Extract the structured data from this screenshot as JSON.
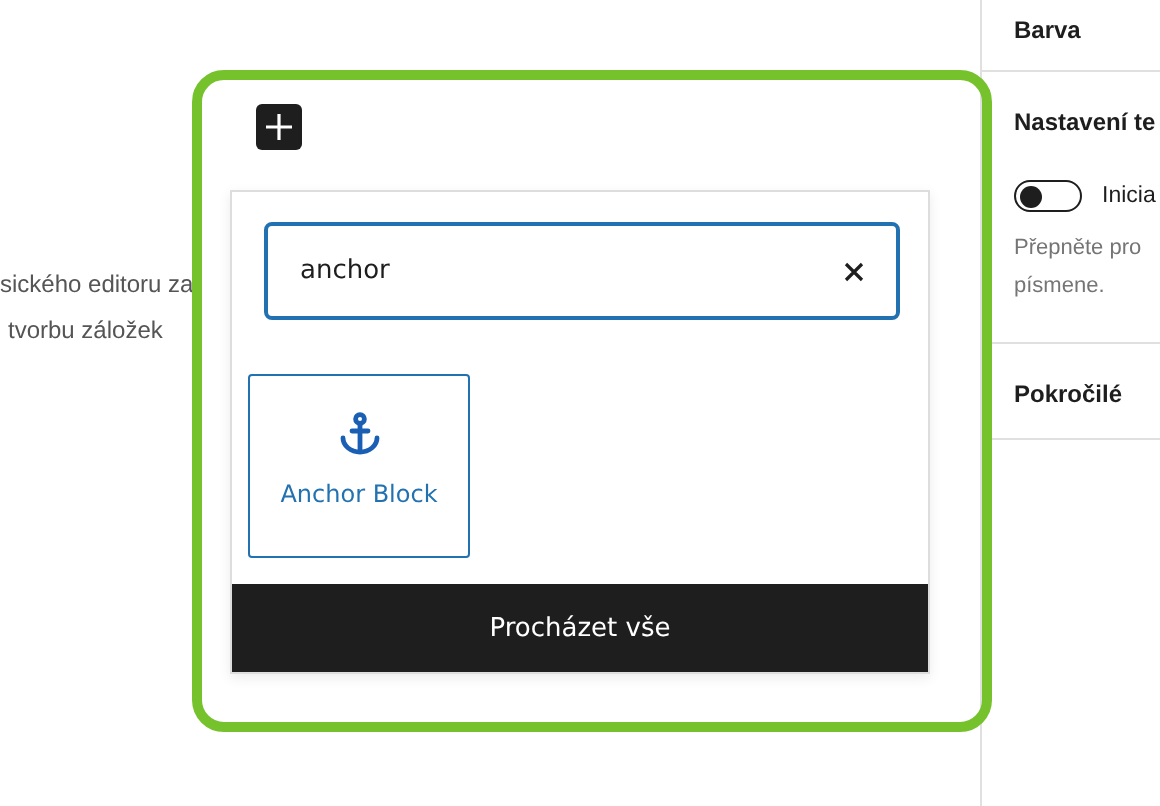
{
  "editor": {
    "lines": [
      "sického editoru za",
      "tvorbu záložek"
    ]
  },
  "inserter": {
    "search": {
      "value": "anchor"
    },
    "results": [
      {
        "label": "Anchor Block",
        "selected": true
      }
    ],
    "browse_button": "Procházet vše"
  },
  "sidebar": {
    "sections": [
      {
        "kind": "header",
        "title": "Barva"
      },
      {
        "kind": "settings",
        "title": "Nastavení te",
        "toggle": {
          "label": "Inicia",
          "on": false
        },
        "help": [
          "Přepněte pro",
          "písmene."
        ]
      },
      {
        "kind": "header",
        "title": "Pokročilé"
      }
    ]
  }
}
